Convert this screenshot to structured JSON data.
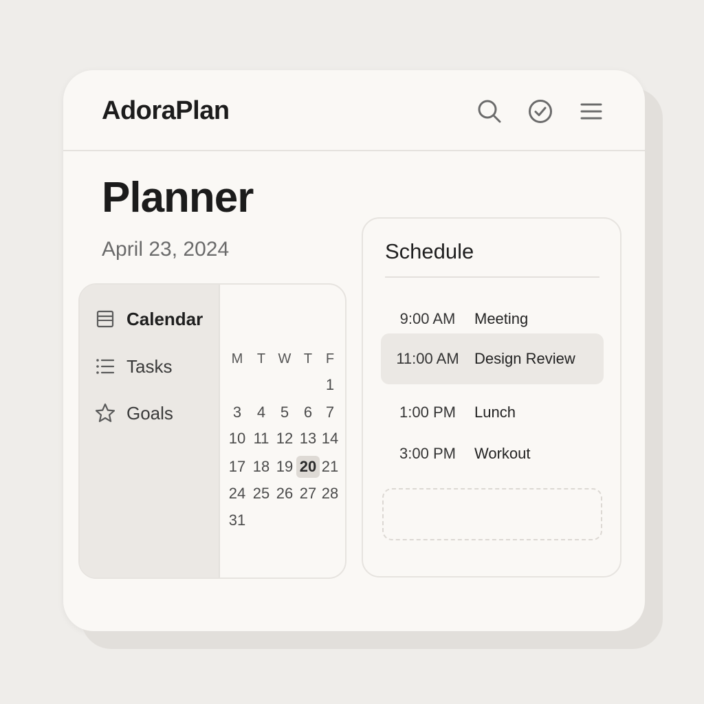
{
  "app": {
    "brand": "AdoraPlan",
    "icons": [
      "search-icon",
      "check-circle-icon",
      "menu-icon"
    ]
  },
  "page": {
    "title": "Planner",
    "date": "April 23, 2024"
  },
  "sidebar": {
    "items": [
      {
        "label": "Calendar",
        "icon": "calendar-icon",
        "active": true
      },
      {
        "label": "Tasks",
        "icon": "list-icon",
        "active": false
      },
      {
        "label": "Goals",
        "icon": "star-icon",
        "active": false
      }
    ]
  },
  "calendar": {
    "weekdays": [
      "M",
      "T",
      "W",
      "T",
      "F"
    ],
    "rows": [
      [
        "",
        "",
        "",
        "",
        "1"
      ],
      [
        "3",
        "4",
        "5",
        "6",
        "7"
      ],
      [
        "10",
        "11",
        "12",
        "13",
        "14"
      ],
      [
        "17",
        "18",
        "19",
        "20",
        "21"
      ],
      [
        "24",
        "25",
        "26",
        "27",
        "28"
      ],
      [
        "31",
        "",
        "",
        "",
        ""
      ]
    ],
    "selected_day": "20"
  },
  "schedule": {
    "title": "Schedule",
    "items": [
      {
        "time": "9:00 AM",
        "event": "Meeting",
        "highlighted": false
      },
      {
        "time": "11:00 AM",
        "event": "Design Review",
        "highlighted": true
      },
      {
        "time": "1:00 PM",
        "event": "Lunch",
        "highlighted": false
      },
      {
        "time": "3:00 PM",
        "event": "Workout",
        "highlighted": false
      }
    ]
  },
  "colors": {
    "background": "#efedea",
    "surface": "#faf8f5",
    "sidebar": "#ebe8e4",
    "highlight": "#ebe8e4",
    "selected_day": "#dedad5",
    "icon_stroke": "#6b6b6b"
  }
}
